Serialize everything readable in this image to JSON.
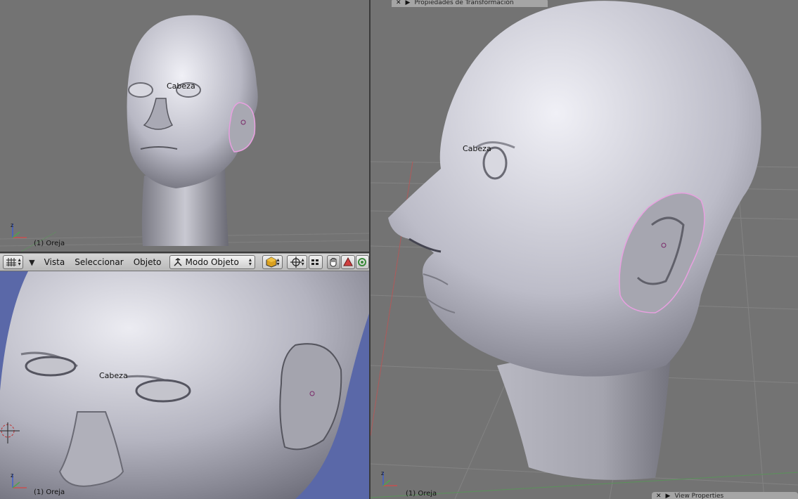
{
  "viewports": {
    "top_left": {
      "object_label": "Cabeza",
      "status": "(1) Oreja"
    },
    "bottom_left": {
      "object_label": "Cabeza",
      "status": "(1) Oreja"
    },
    "right": {
      "object_label": "Cabeza",
      "status": "(1) Oreja"
    }
  },
  "header": {
    "menus": [
      "Vista",
      "Seleccionar",
      "Objeto"
    ],
    "mode": "Modo Objeto"
  },
  "panels": {
    "transform_title": "Propiedades de Transformación",
    "view_title": "View Properties"
  },
  "colors": {
    "viewport_gray": "#737373",
    "viewport_blue": "#5a68a8",
    "selection_outline": "#e8a0e0",
    "grid_line": "#8a8a8a",
    "x_axis": "#c85050",
    "y_axis": "#50a050",
    "z_axis": "#4060d0"
  },
  "icons": {
    "view_type": "grid-icon",
    "mode": "object-mode-icon",
    "draw_type": "solid-cube-icon",
    "pivot": "pivot-crosshair-icon",
    "manipulator_hand": "hand-icon",
    "manipulator_translate": "translate-arrow-icon",
    "manipulator_rotate": "rotate-circle-icon"
  }
}
